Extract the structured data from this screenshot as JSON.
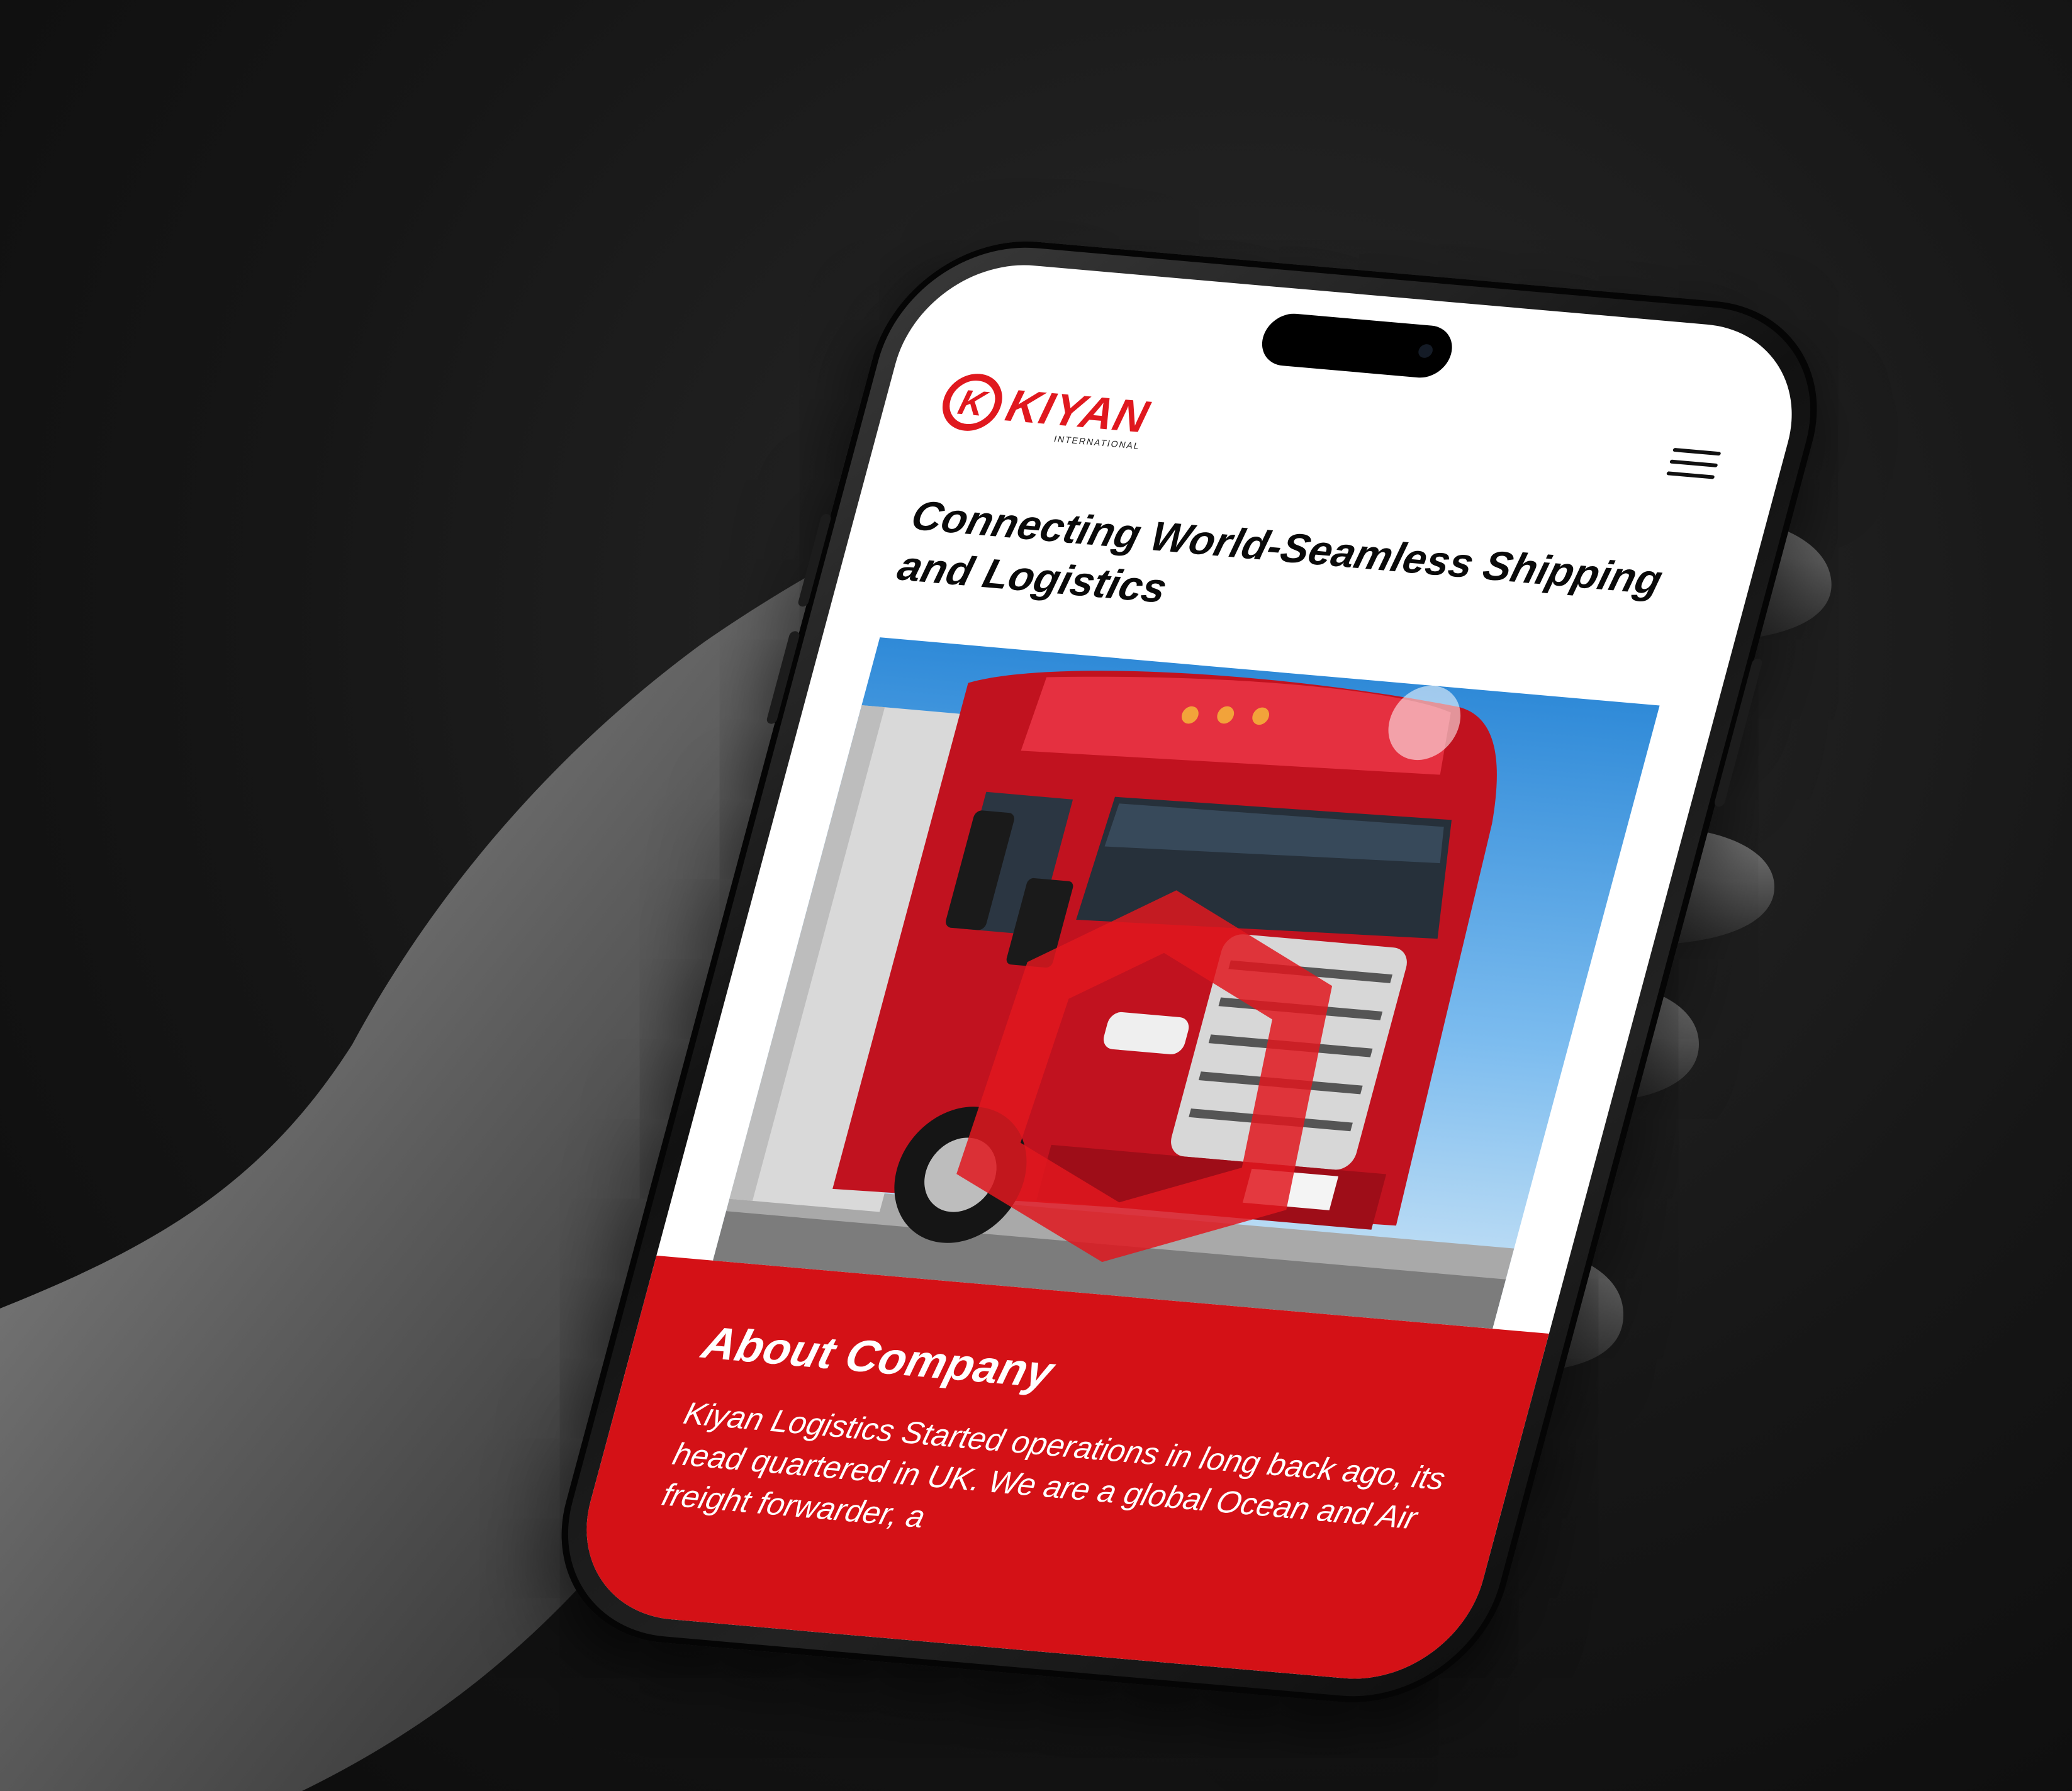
{
  "brand": {
    "logo_letter": "K",
    "name": "KIYAN",
    "subtitle": "INTERNATIONAL",
    "accent_color": "#e0181e"
  },
  "header": {
    "menu_icon": "hamburger-menu-icon"
  },
  "hero": {
    "title": "Connecting World-Seamless Shipping and Logistics",
    "image_description_icon": "red-truck-image"
  },
  "about": {
    "heading": "About Company",
    "body": "Kiyan Logistics Started operations in long back ago, its head quartered in UK. We are a global Ocean and Air freight forwarder, a",
    "background_color": "#d41116"
  }
}
